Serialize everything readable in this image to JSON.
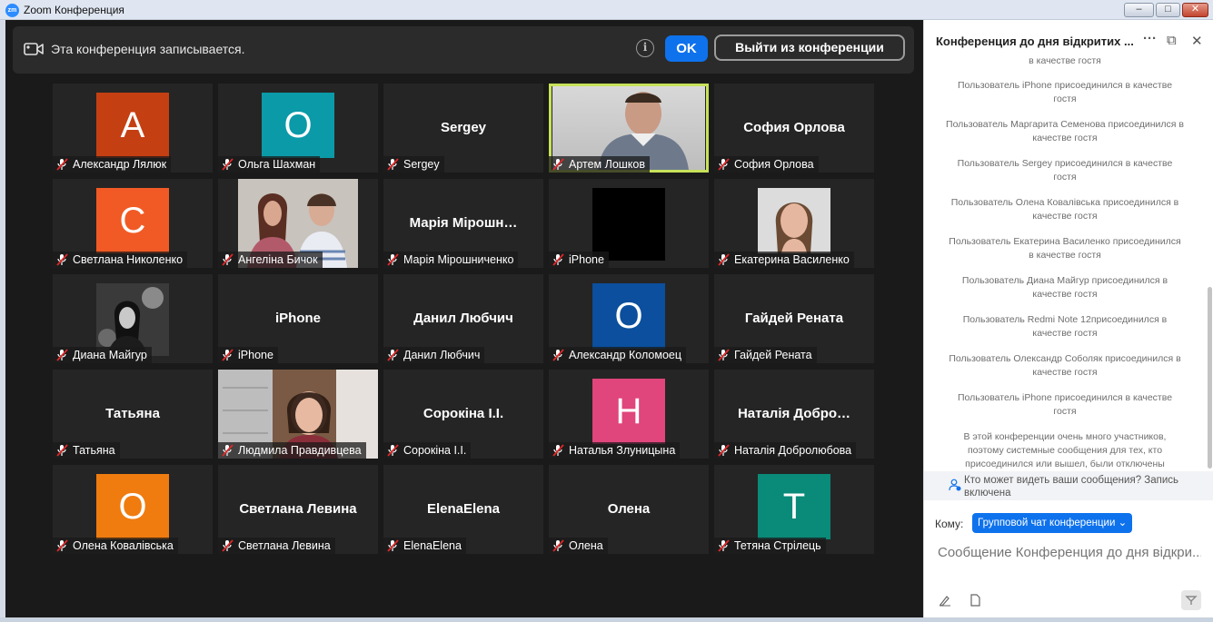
{
  "window": {
    "title": "Zoom Конференция",
    "logo": "zm",
    "minimize": "–",
    "maximize": "□",
    "close": "✕"
  },
  "recording_bar": {
    "text": "Эта конференция записывается.",
    "info": "i",
    "ok_label": "OK",
    "leave_label": "Выйти из конференции"
  },
  "participants": [
    {
      "name": "Александр Лялюк",
      "initial": "A",
      "color": "#c43f12",
      "display": "",
      "type": "avatar"
    },
    {
      "name": "Ольга Шахман",
      "initial": "O",
      "color": "#0b9aa8",
      "display": "",
      "type": "avatar"
    },
    {
      "name": "Sergey",
      "initial": "",
      "color": "",
      "display": "Sergey",
      "type": "text"
    },
    {
      "name": "Артем Лошков",
      "initial": "",
      "color": "",
      "display": "",
      "type": "video"
    },
    {
      "name": "София Орлова",
      "initial": "",
      "color": "",
      "display": "София Орлова",
      "type": "text"
    },
    {
      "name": "Светлана Николенко",
      "initial": "C",
      "color": "#f15a24",
      "display": "",
      "type": "avatar"
    },
    {
      "name": "Ангеліна Бичок",
      "initial": "",
      "color": "",
      "display": "",
      "type": "photo-two"
    },
    {
      "name": "Марія Мірошниченко",
      "initial": "",
      "color": "",
      "display": "Марія Мірошн…",
      "type": "text"
    },
    {
      "name": "iPhone",
      "initial": "",
      "color": "",
      "display": "",
      "type": "black"
    },
    {
      "name": "Екатерина Василенко",
      "initial": "",
      "color": "",
      "display": "",
      "type": "photo-portrait"
    },
    {
      "name": "Диана Майгур",
      "initial": "",
      "color": "",
      "display": "",
      "type": "photo-bw"
    },
    {
      "name": "iPhone",
      "initial": "",
      "color": "",
      "display": "iPhone",
      "type": "text"
    },
    {
      "name": "Данил Любчич",
      "initial": "",
      "color": "",
      "display": "Данил Любчич",
      "type": "text"
    },
    {
      "name": "Александр Коломоец",
      "initial": "O",
      "color": "#0b4f9e",
      "display": "",
      "type": "avatar"
    },
    {
      "name": "Гайдей Рената",
      "initial": "",
      "color": "",
      "display": "Гайдей Рената",
      "type": "text"
    },
    {
      "name": "Татьяна",
      "initial": "",
      "color": "",
      "display": "Татьяна",
      "type": "text"
    },
    {
      "name": "Людмила Правдивцева",
      "initial": "",
      "color": "",
      "display": "",
      "type": "video-room"
    },
    {
      "name": "Сорокіна І.І.",
      "initial": "",
      "color": "",
      "display": "Сорокіна І.І.",
      "type": "text"
    },
    {
      "name": "Наталья Злуницына",
      "initial": "H",
      "color": "#e0457b",
      "display": "",
      "type": "avatar"
    },
    {
      "name": "Наталія Добролюбова",
      "initial": "",
      "color": "",
      "display": "Наталія Добро…",
      "type": "text"
    },
    {
      "name": "Олена Ковалівська",
      "initial": "O",
      "color": "#f07b0f",
      "display": "",
      "type": "avatar"
    },
    {
      "name": "Светлана Левина",
      "initial": "",
      "color": "",
      "display": "Светлана Левина",
      "type": "text"
    },
    {
      "name": "ElenaElena",
      "initial": "",
      "color": "",
      "display": "ElenaElena",
      "type": "text"
    },
    {
      "name": "Олена",
      "initial": "",
      "color": "",
      "display": "Олена",
      "type": "text"
    },
    {
      "name": "Тетяна Стрілець",
      "initial": "T",
      "color": "#0a8a78",
      "display": "",
      "type": "avatar"
    }
  ],
  "chat": {
    "title": "Конференция до дня відкритих ...",
    "more_icon": "···",
    "popout_icon": "⧉",
    "close_icon": "✕",
    "messages": [
      "в качестве гостя",
      "Пользователь iPhone присоединился в качестве гостя",
      "Пользователь Маргарита Семенова присоединился в качестве гостя",
      "Пользователь Sergey присоединился в качестве гостя",
      "Пользователь Олена Ковалівська присоединился в качестве гостя",
      "Пользователь Екатерина Василенко присоединился в качестве гостя",
      "Пользователь Диана Майгур присоединился в качестве гостя",
      "Пользователь Redmi Note 12присоединился в качестве гостя",
      "Пользователь Олександр Соболяк присоединился в качестве гостя",
      "Пользователь iPhone присоединился в качестве гостя",
      "В этой конференции очень много участников, поэтому системные сообщения для тех, кто присоединился или вышел, были отключены"
    ],
    "who_can_see": "Кто может видеть ваши сообщения? Запись включена",
    "to_label": "Кому:",
    "to_value": "Групповой чат конференции ⌄",
    "input_placeholder": "Сообщение Конференция до дня відкри..."
  }
}
